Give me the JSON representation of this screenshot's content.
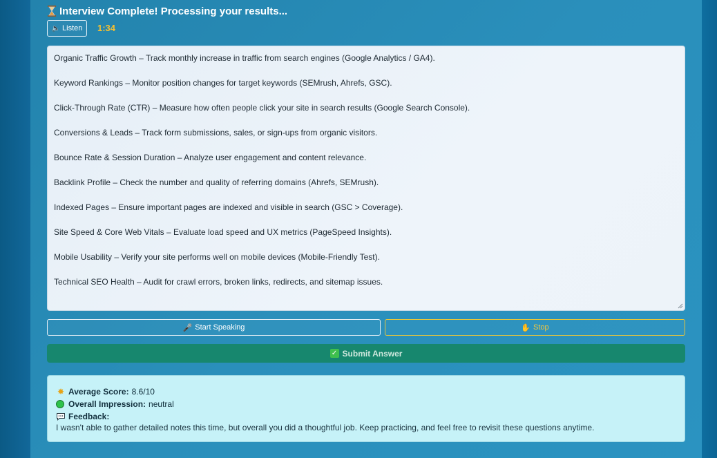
{
  "header": {
    "title": "Interview Complete! Processing your results...",
    "title_icon": "hourglass-icon",
    "listen_label": "Listen",
    "timer": "1:34"
  },
  "answer": {
    "lines": [
      "Organic Traffic Growth – Track monthly increase in traffic from search engines (Google Analytics / GA4).",
      "Keyword Rankings – Monitor position changes for target keywords (SEMrush, Ahrefs, GSC).",
      "Click-Through Rate (CTR) – Measure how often people click your site in search results (Google Search Console).",
      "Conversions & Leads – Track form submissions, sales, or sign-ups from organic visitors.",
      "Bounce Rate & Session Duration – Analyze user engagement and content relevance.",
      "Backlink Profile – Check the number and quality of referring domains (Ahrefs, SEMrush).",
      "Indexed Pages – Ensure important pages are indexed and visible in search (GSC > Coverage).",
      "Site Speed & Core Web Vitals – Evaluate load speed and UX metrics (PageSpeed Insights).",
      "Mobile Usability – Verify your site performs well on mobile devices (Mobile-Friendly Test).",
      "Technical SEO Health – Audit for crawl errors, broken links, redirects, and sitemap issues."
    ]
  },
  "controls": {
    "start_label": "Start Speaking",
    "stop_label": "Stop",
    "submit_label": "Submit Answer"
  },
  "results": {
    "score_label": "Average Score:",
    "score_value": "8.6/10",
    "impression_label": "Overall Impression:",
    "impression_value": "neutral",
    "feedback_label": "Feedback:",
    "feedback_text": "I wasn't able to gather detailed notes this time, but overall you did a thoughtful job. Keep practicing, and feel free to revisit these questions anytime."
  },
  "colors": {
    "timer": "#f6c02f",
    "submit_bg": "#17876e",
    "results_bg": "#c6f2f8",
    "stop_accent": "#e8c63a"
  }
}
